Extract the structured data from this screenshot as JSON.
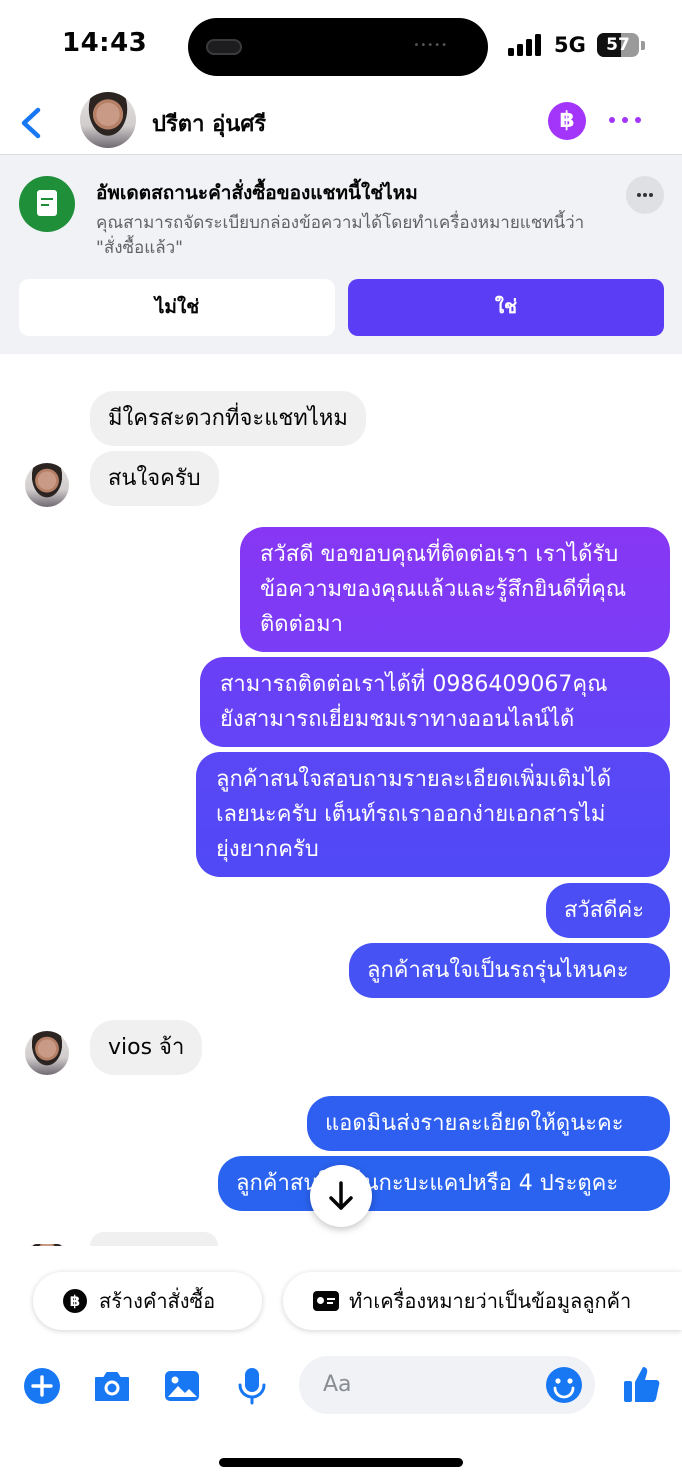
{
  "status_bar": {
    "time": "14:43",
    "network": "5G",
    "battery": "57",
    "battery_level": 0.57
  },
  "header": {
    "contact_name": "ปรีตา อุ่นศรี",
    "order_icon": "baht-icon"
  },
  "banner": {
    "title": "อัพเดตสถานะคำสั่งซื้อของแชทนี้ใช่ไหม",
    "description": "คุณสามารถจัดระเบียบกล่องข้อความได้โดยทำเครื่องหมายแชทนี้ว่า \"สั่งซื้อแล้ว\"",
    "no_label": "ไม่ใช่",
    "yes_label": "ใช่"
  },
  "messages": [
    {
      "dir": "in",
      "text": "มีใครสะดวกที่จะแชทไหม"
    },
    {
      "dir": "in",
      "text": "สนใจครับ"
    },
    {
      "dir": "out",
      "lines": [
        "สวัสดี ขอขอบคุณที่ติดต่อเรา เราได้รับ",
        "ข้อความของคุณแล้วและรู้สึกยินดีที่คุณ",
        "ติดต่อมา"
      ]
    },
    {
      "dir": "out",
      "lines": [
        "สามารถติดต่อเราได้ที่ 0986409067คุณ",
        "ยังสามารถเยี่ยมชมเราทางออนไลน์ได้"
      ]
    },
    {
      "dir": "out",
      "lines": [
        "ลูกค้าสนใจสอบถามรายละเอียดเพิ่มเติมได้",
        "เลยนะครับ เต็นท์รถเราออกง่ายเอกสารไม่",
        "ยุ่งยากครับ"
      ]
    },
    {
      "dir": "out",
      "text": "สวัสดีค่ะ"
    },
    {
      "dir": "out",
      "text": "ลูกค้าสนใจเป็นรถรุ่นไหนคะ"
    },
    {
      "dir": "in",
      "text": "vios จ้า"
    },
    {
      "dir": "out",
      "text": "แอดมินส่งรายละเอียดให้ดูนะคะ"
    },
    {
      "dir": "out",
      "text": "ลูกค้าสนใจเป็นกะบะแคปหรือ 4 ประตูคะ"
    }
  ],
  "quick_actions": {
    "create_order": "สร้างคำสั่งซื้อ",
    "mark_customer": "ทำเครื่องหมายว่าเป็นข้อมูลลูกค้า"
  },
  "composer": {
    "placeholder": "Aa"
  },
  "colors": {
    "accent": "#5b3df5",
    "messenger_blue": "#1877f2",
    "order_purple": "#a334fa",
    "banner_green": "#1f8f3a"
  }
}
